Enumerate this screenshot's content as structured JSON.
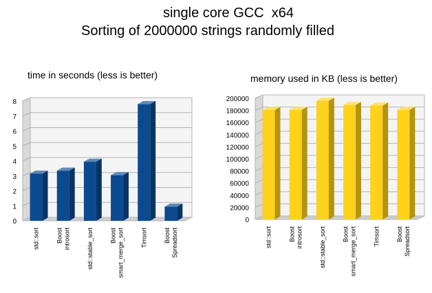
{
  "title": {
    "line1": "single core GCC  x64",
    "line2": "Sorting of 2000000 strings randomly filled"
  },
  "chart_data": [
    {
      "type": "bar",
      "title": "time in seconds (less is better)",
      "categories": [
        [
          "std::sort"
        ],
        [
          "Boost",
          "introsort"
        ],
        [
          "std::stable_sort"
        ],
        [
          "Boost",
          "smart_merge_sort"
        ],
        [
          "Timsort"
        ],
        [
          "Boost",
          "Spreadsort"
        ]
      ],
      "values": [
        3.15,
        3.35,
        3.95,
        3.05,
        7.8,
        0.95
      ],
      "ylim": [
        0,
        8
      ],
      "yticks": [
        0,
        1,
        2,
        3,
        4,
        5,
        6,
        7,
        8
      ],
      "grid": true,
      "color": "#0b4a8f",
      "legend": "none"
    },
    {
      "type": "bar",
      "title": "memory used in KB (less is better)",
      "categories": [
        [
          "std::sort"
        ],
        [
          "Boost",
          "introsort"
        ],
        [
          "std::stable_sort"
        ],
        [
          "Boost",
          "smart_merge_sort"
        ],
        [
          "Timsort"
        ],
        [
          "Boost",
          "Spreadsort"
        ]
      ],
      "values": [
        181000,
        181000,
        196000,
        189000,
        188000,
        181000
      ],
      "ylim": [
        0,
        200000
      ],
      "yticks": [
        0,
        20000,
        40000,
        60000,
        80000,
        100000,
        120000,
        140000,
        160000,
        180000,
        200000
      ],
      "grid": true,
      "color": "#ffd21a",
      "legend": "none"
    }
  ]
}
